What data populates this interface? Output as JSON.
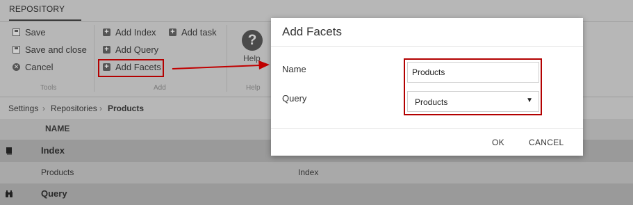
{
  "ribbon": {
    "tab": "REPOSITORY",
    "tools": {
      "save": "Save",
      "save_close": "Save and close",
      "cancel": "Cancel",
      "label": "Tools"
    },
    "add": {
      "add_index": "Add Index",
      "add_task": "Add task",
      "add_query": "Add Query",
      "add_facets": "Add Facets",
      "label": "Add"
    },
    "help": {
      "button": "Help",
      "label": "Help",
      "icon": "?"
    }
  },
  "breadcrumb": {
    "items": [
      "Settings",
      "Repositories",
      "Products"
    ],
    "sep": "›"
  },
  "list": {
    "header": "NAME",
    "groups": [
      {
        "title": "Index",
        "rows": [
          {
            "name": "Products",
            "type": "Index"
          }
        ]
      },
      {
        "title": "Query",
        "rows": []
      }
    ]
  },
  "dialog": {
    "title": "Add Facets",
    "name_label": "Name",
    "name_value": "Products",
    "query_label": "Query",
    "query_value": "Products",
    "select_caret": "▼",
    "ok": "OK",
    "cancel": "CANCEL"
  },
  "colors": {
    "highlight": "#b30000",
    "overlay": "#a9a9a9"
  }
}
